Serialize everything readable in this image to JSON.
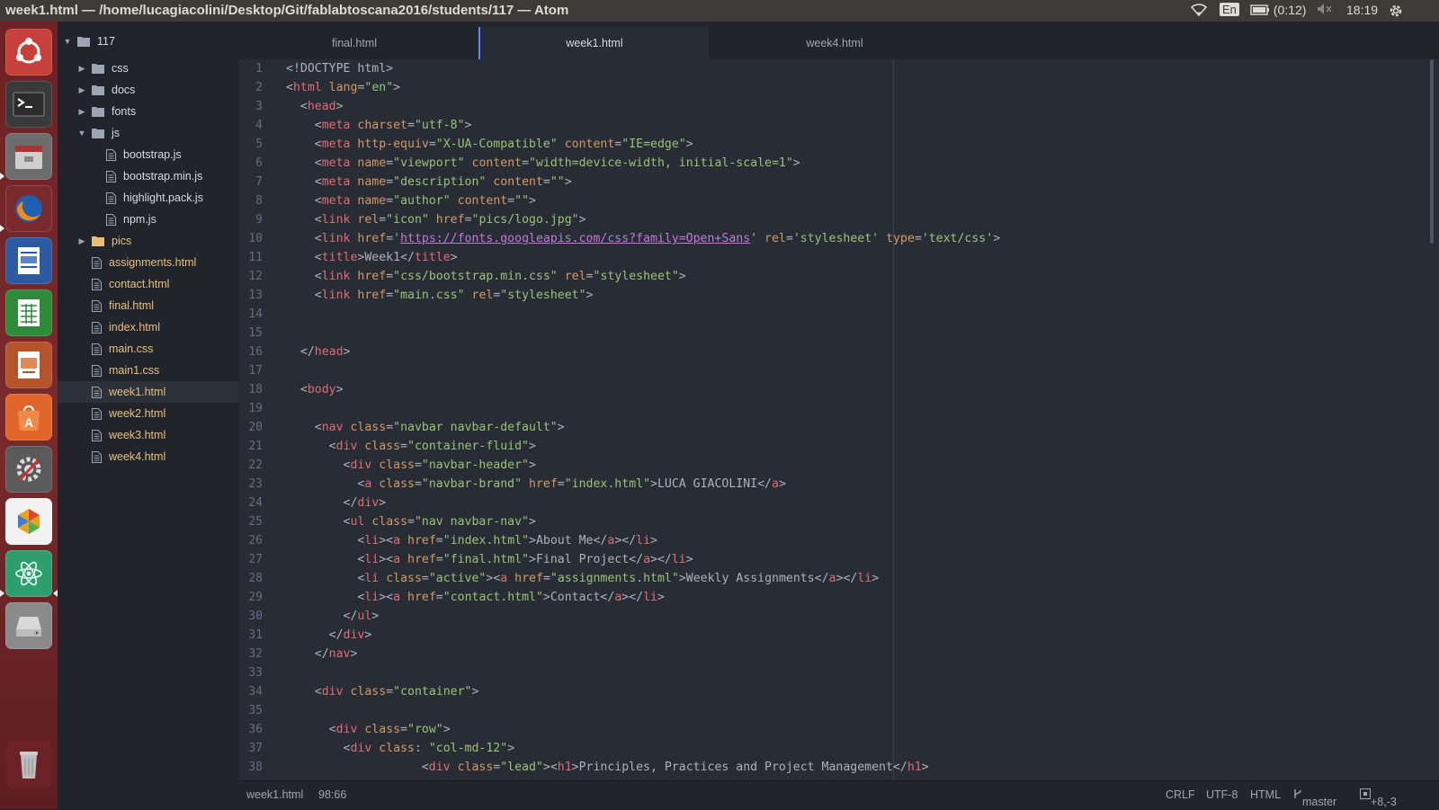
{
  "window": {
    "title": "week1.html — /home/lucagiacolini/Desktop/Git/fablabtoscana2016/students/117 — Atom"
  },
  "indicators": {
    "language": "En",
    "battery": "(0:12)",
    "clock": "18:19"
  },
  "launcher": {
    "items": [
      "dash-home",
      "terminal",
      "files",
      "firefox",
      "writer",
      "calc",
      "impress",
      "software-center",
      "system-settings",
      "unity-tweak",
      "atom",
      "disk",
      "trash"
    ]
  },
  "tree": {
    "root": "117",
    "folders": [
      "css",
      "docs",
      "fonts",
      "js"
    ],
    "js_files": [
      "bootstrap.js",
      "bootstrap.min.js",
      "highlight.pack.js",
      "npm.js"
    ],
    "pics": "pics",
    "files": [
      "assignments.html",
      "contact.html",
      "final.html",
      "index.html",
      "main.css",
      "main1.css",
      "week1.html",
      "week2.html",
      "week3.html",
      "week4.html"
    ],
    "selected": "week1.html"
  },
  "tabs": [
    "final.html",
    "week1.html",
    "week4.html"
  ],
  "editor": {
    "line_numbers": [
      "1",
      "2",
      "3",
      "4",
      "5",
      "6",
      "7",
      "8",
      "9",
      "10",
      "11",
      "12",
      "13",
      "14",
      "15",
      "16",
      "17",
      "18",
      "19",
      "20",
      "21",
      "22",
      "23",
      "24",
      "25",
      "26",
      "27",
      "28",
      "29",
      "30",
      "31",
      "32",
      "33",
      "34",
      "35",
      "36",
      "37",
      "38"
    ]
  },
  "status": {
    "file": "week1.html",
    "cursor": "98:66",
    "line_ending": "CRLF",
    "encoding": "UTF-8",
    "grammar": "HTML",
    "branch": "master",
    "diff": "+8,-3"
  }
}
